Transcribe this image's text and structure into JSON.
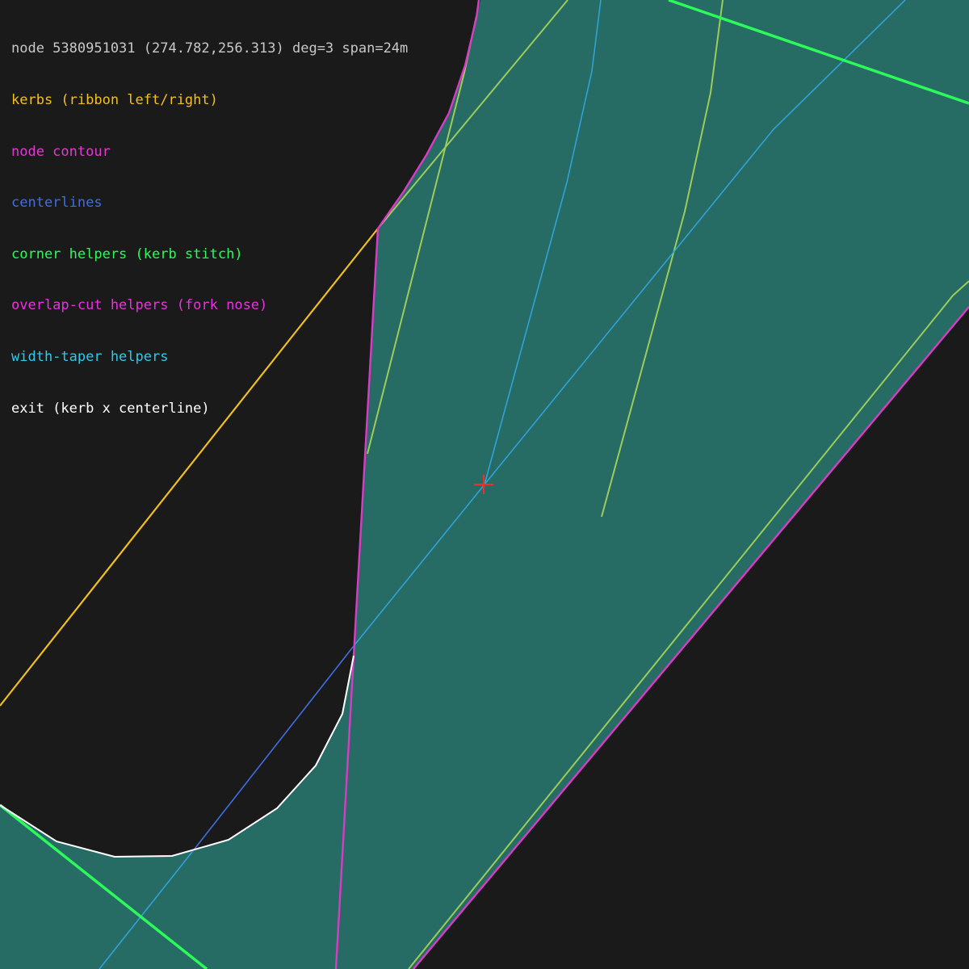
{
  "header": "node 5380951031 (274.782,256.313) deg=3 span=24m",
  "legend": [
    {
      "label": "kerbs (ribbon left/right)",
      "color": "#f2c01e"
    },
    {
      "label": "node contour",
      "color": "#e03bd0"
    },
    {
      "label": "centerlines",
      "color": "#3f6ee0"
    },
    {
      "label": "corner helpers (kerb stitch)",
      "color": "#2dfa5a"
    },
    {
      "label": "overlap-cut helpers (fork nose)",
      "color": "#ea31e0"
    },
    {
      "label": "width-taper helpers",
      "color": "#2ec9ea"
    },
    {
      "label": "exit (kerb x centerline)",
      "color": "#ffffff"
    }
  ],
  "colors": {
    "background": "#1b1a1b",
    "fill": "#266b64",
    "header_text": "#c8c8c8",
    "kerb": "#f2c01e",
    "contour": "#d83cc6",
    "centerline": "#3f6ee0",
    "taper": "#30a2d8",
    "corner": "#2dfa5a",
    "helper": "#9ccc5a",
    "exit": "#ffffff",
    "node_marker": "#e8322a"
  },
  "icons": {
    "node_marker": "cross-icon"
  }
}
